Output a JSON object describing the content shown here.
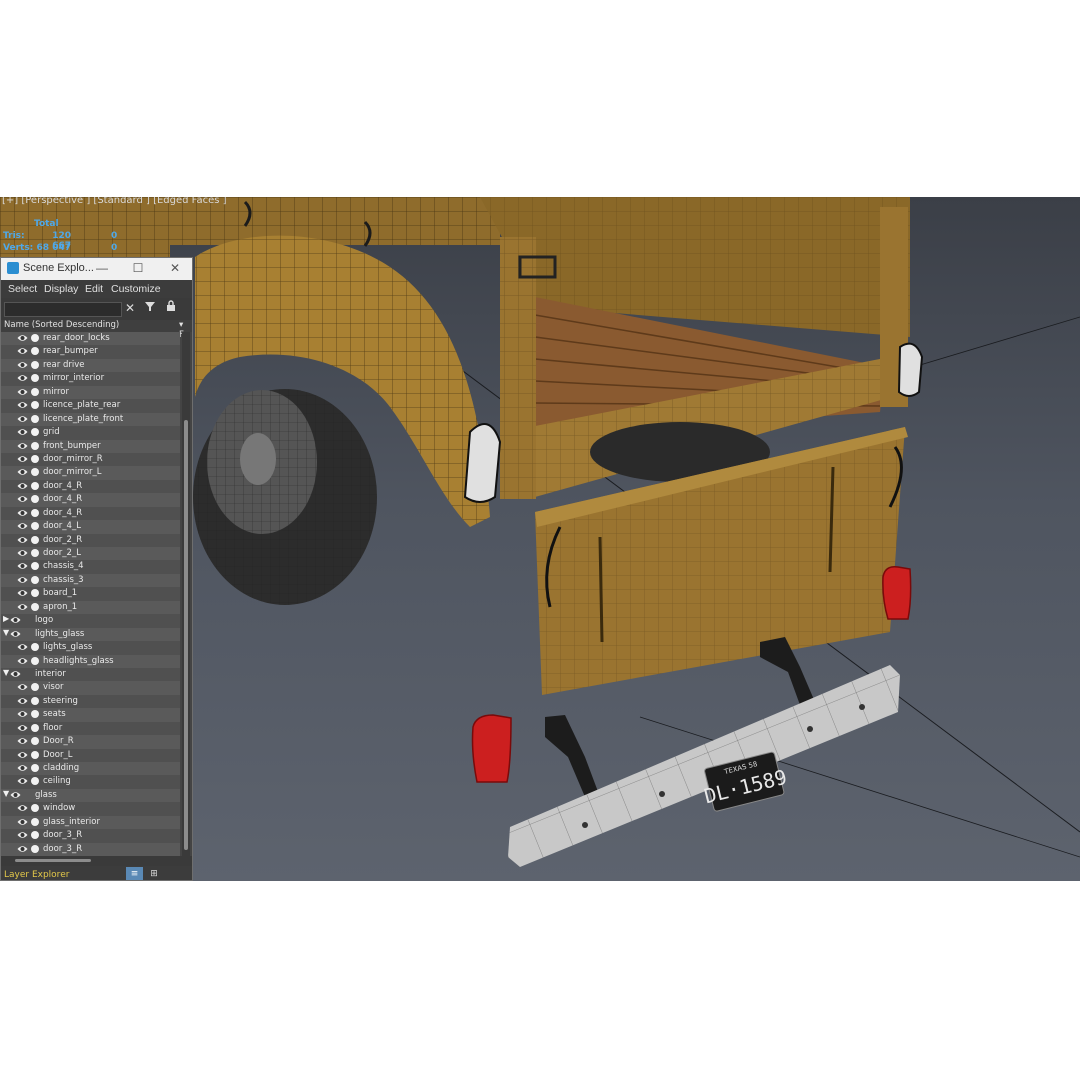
{
  "viewport": {
    "label": "[+] [Perspective ] [Standard ] [Edged Faces ]",
    "stats": {
      "header": "Total",
      "rows": [
        {
          "key": "Tris:",
          "value": "120 667",
          "zero": "0"
        },
        {
          "key": "Verts:",
          "value": "68 047",
          "zero": "0"
        }
      ]
    },
    "license_plate": {
      "state_text": "TEXAS 58",
      "number": "DL·1589"
    }
  },
  "scene_explorer": {
    "title": "Scene Explo...",
    "window_buttons": {
      "minimize": "—",
      "maximize": "☐",
      "close": "✕"
    },
    "menu": [
      "Select",
      "Display",
      "Edit",
      "Customize"
    ],
    "column_header": "Name (Sorted Descending)",
    "column_header_right": "▾ F...",
    "items": [
      {
        "label": "rear_door_locks",
        "level": 1
      },
      {
        "label": "rear_bumper",
        "level": 1
      },
      {
        "label": "rear drive",
        "level": 1
      },
      {
        "label": "mirror_interior",
        "level": 1
      },
      {
        "label": "mirror",
        "level": 1
      },
      {
        "label": "licence_plate_rear",
        "level": 1
      },
      {
        "label": "licence_plate_front",
        "level": 1
      },
      {
        "label": "grid",
        "level": 1
      },
      {
        "label": "front_bumper",
        "level": 1
      },
      {
        "label": "door_mirror_R",
        "level": 1
      },
      {
        "label": "door_mirror_L",
        "level": 1
      },
      {
        "label": "door_4_R",
        "level": 1
      },
      {
        "label": "door_4_R",
        "level": 1
      },
      {
        "label": "door_4_R",
        "level": 1
      },
      {
        "label": "door_4_L",
        "level": 1
      },
      {
        "label": "door_2_R",
        "level": 1
      },
      {
        "label": "door_2_L",
        "level": 1
      },
      {
        "label": "chassis_4",
        "level": 1
      },
      {
        "label": "chassis_3",
        "level": 1
      },
      {
        "label": "board_1",
        "level": 1
      },
      {
        "label": "apron_1",
        "level": 1
      },
      {
        "label": "logo",
        "level": 0,
        "toggle": "collapsed"
      },
      {
        "label": "lights_glass",
        "level": 0,
        "toggle": "expanded"
      },
      {
        "label": "lights_glass",
        "level": 1
      },
      {
        "label": "headlights_glass",
        "level": 1
      },
      {
        "label": "interior",
        "level": 0,
        "toggle": "expanded"
      },
      {
        "label": "visor",
        "level": 1
      },
      {
        "label": "steering",
        "level": 1
      },
      {
        "label": "seats",
        "level": 1
      },
      {
        "label": "floor",
        "level": 1
      },
      {
        "label": "Door_R",
        "level": 1
      },
      {
        "label": "Door_L",
        "level": 1
      },
      {
        "label": "cladding",
        "level": 1
      },
      {
        "label": "ceiling",
        "level": 1
      },
      {
        "label": "glass",
        "level": 0,
        "toggle": "expanded"
      },
      {
        "label": "window",
        "level": 1
      },
      {
        "label": "glass_interior",
        "level": 1
      },
      {
        "label": "door_3_R",
        "level": 1
      },
      {
        "label": "door_3_R",
        "level": 1
      }
    ],
    "footer_label": "Layer Explorer"
  },
  "colors": {
    "body_paint": "#a07a34",
    "wireframe": "#2a1e08",
    "bed_wood": "#8a5a30",
    "tail_light": "#cc1f1f",
    "bumper": "#c8c8c8",
    "stats_blue": "#4fa8e8",
    "footer_yellow": "#e3c84a"
  }
}
